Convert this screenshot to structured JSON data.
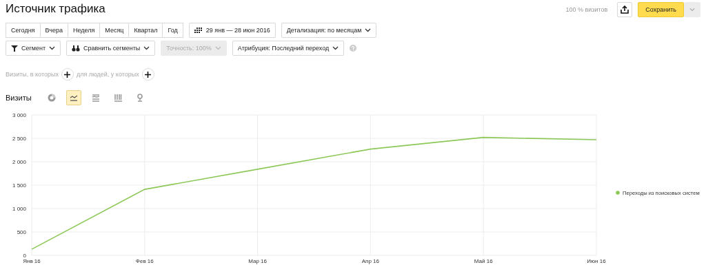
{
  "title": "Источник трафика",
  "header_right": {
    "share": "100 % визитов",
    "save_button": "Сохранить"
  },
  "periods": [
    {
      "label": "Сегодня",
      "selected": false
    },
    {
      "label": "Вчера",
      "selected": false
    },
    {
      "label": "Неделя",
      "selected": false
    },
    {
      "label": "Месяц",
      "selected": false
    },
    {
      "label": "Квартал",
      "selected": false
    },
    {
      "label": "Год",
      "selected": false
    }
  ],
  "date_range": "29 янв — 28 июн 2016",
  "detail": "Детализация: по месяцам",
  "segment": "Сегмент",
  "compare": "Сравнить сегменты",
  "accuracy": {
    "label": "Точность: 100%",
    "disabled": true
  },
  "attribution": "Атрибуция: Последний переход",
  "filter": {
    "visits_label": "Визиты, в которых",
    "people_label": "для людей, у которых"
  },
  "metric": {
    "label": "Визиты",
    "chart_types": [
      {
        "kind": "pie",
        "selected": false
      },
      {
        "kind": "line",
        "selected": true
      },
      {
        "kind": "area",
        "selected": false
      },
      {
        "kind": "bar",
        "selected": false
      },
      {
        "kind": "map",
        "selected": false
      }
    ]
  },
  "chart_data": {
    "type": "line",
    "categories": [
      "Янв 16",
      "Фев 16",
      "Мар 16",
      "Апр 16",
      "Май 16",
      "Июн 16"
    ],
    "series": [
      {
        "name": "Переходы из поисковых систем",
        "color": "#8cc857",
        "values": [
          130,
          1410,
          1840,
          2270,
          2520,
          2470
        ]
      }
    ],
    "ylim": [
      0,
      3000
    ],
    "grid": true,
    "yticks": [
      {
        "value": 0,
        "label": "0"
      },
      {
        "value": 500,
        "label": "500"
      },
      {
        "value": 1000,
        "label": "1 000"
      },
      {
        "value": 1500,
        "label": "1 500"
      },
      {
        "value": 2000,
        "label": "2 000"
      },
      {
        "value": 2500,
        "label": "2 500"
      },
      {
        "value": 3000,
        "label": "3 000"
      }
    ]
  }
}
